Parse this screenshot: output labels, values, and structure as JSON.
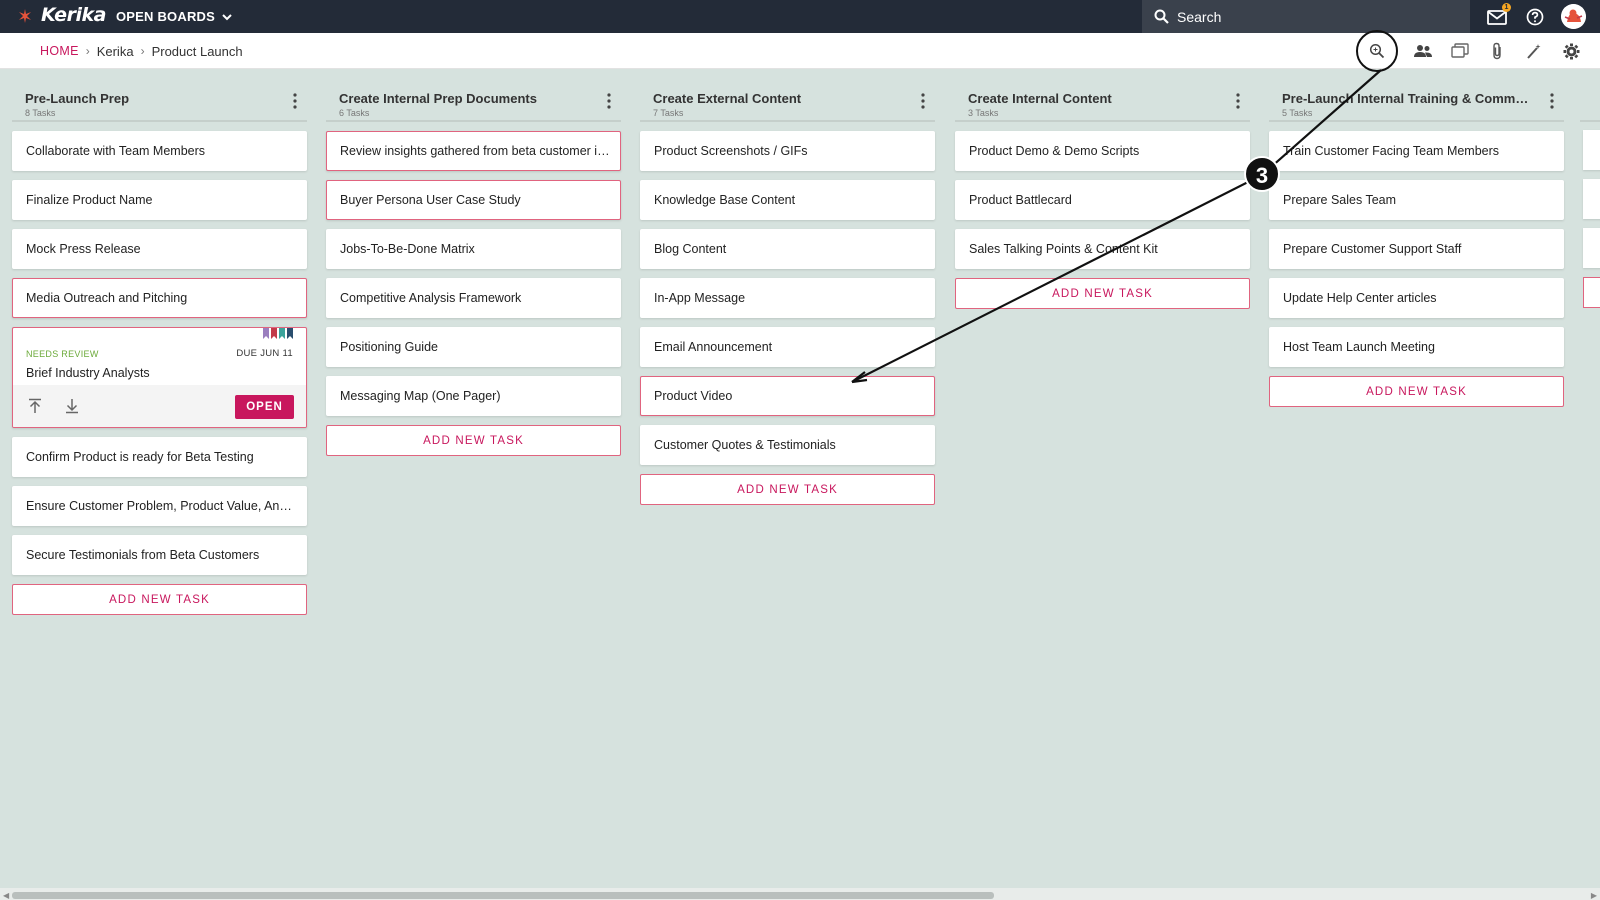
{
  "app": {
    "logo_text": "Kerika",
    "open_boards_label": "OPEN BOARDS",
    "search_placeholder": "Search",
    "mail_badge": "1"
  },
  "breadcrumb": {
    "home": "HOME",
    "workspace": "Kerika",
    "board": "Product Launch"
  },
  "columns": [
    {
      "title": "Pre-Launch Prep",
      "count": "8 Tasks",
      "cards_before": [
        {
          "label": "Collaborate with Team Members",
          "highlight": false
        },
        {
          "label": "Finalize Product Name",
          "highlight": false
        },
        {
          "label": "Mock Press Release",
          "highlight": false
        },
        {
          "label": "Media Outreach and Pitching",
          "highlight": true
        }
      ],
      "expanded_card": {
        "status": "NEEDS REVIEW",
        "due": "DUE JUN 11",
        "title": "Brief Industry Analysts",
        "open_label": "OPEN",
        "tag_colors": [
          "#9b7fbf",
          "#c23b4a",
          "#3aa39b",
          "#2a4e6e"
        ]
      },
      "cards_after": [
        {
          "label": "Confirm Product is ready for Beta Testing",
          "highlight": false
        },
        {
          "label": "Ensure Customer Problem, Product Value, And U...",
          "highlight": false
        },
        {
          "label": "Secure Testimonials from Beta Customers",
          "highlight": false
        }
      ],
      "add_label": "ADD NEW TASK"
    },
    {
      "title": "Create Internal Prep Documents",
      "count": "6 Tasks",
      "cards": [
        {
          "label": "Review insights gathered from beta customer in...",
          "highlight": true
        },
        {
          "label": "Buyer Persona User Case Study",
          "highlight": true
        },
        {
          "label": "Jobs-To-Be-Done Matrix",
          "highlight": false
        },
        {
          "label": "Competitive Analysis Framework",
          "highlight": false
        },
        {
          "label": "Positioning Guide",
          "highlight": false
        },
        {
          "label": "Messaging Map (One Pager)",
          "highlight": false
        }
      ],
      "add_label": "ADD NEW TASK"
    },
    {
      "title": "Create External Content",
      "count": "7 Tasks",
      "cards": [
        {
          "label": "Product Screenshots / GIFs",
          "highlight": false
        },
        {
          "label": "Knowledge Base Content",
          "highlight": false
        },
        {
          "label": "Blog Content",
          "highlight": false
        },
        {
          "label": "In-App Message",
          "highlight": false
        },
        {
          "label": "Email Announcement",
          "highlight": false
        },
        {
          "label": "Product Video",
          "highlight": true
        },
        {
          "label": "Customer Quotes & Testimonials",
          "highlight": false
        }
      ],
      "add_label": "ADD NEW TASK"
    },
    {
      "title": "Create Internal Content",
      "count": "3 Tasks",
      "cards": [
        {
          "label": "Product Demo & Demo Scripts",
          "highlight": false
        },
        {
          "label": "Product Battlecard",
          "highlight": false
        },
        {
          "label": "Sales Talking Points & Content Kit",
          "highlight": false
        }
      ],
      "add_label": "ADD NEW TASK"
    },
    {
      "title": "Pre-Launch Internal Training & Communi...",
      "count": "5 Tasks",
      "cards": [
        {
          "label": "Train Customer Facing Team Members",
          "highlight": false
        },
        {
          "label": "Prepare Sales Team",
          "highlight": false
        },
        {
          "label": "Prepare Customer Support Staff",
          "highlight": false
        },
        {
          "label": "Update Help Center articles",
          "highlight": false
        },
        {
          "label": "Host Team Launch Meeting",
          "highlight": false
        }
      ],
      "add_label": "ADD NEW TASK"
    }
  ],
  "annotation": {
    "step_number": "3"
  },
  "colors": {
    "accent": "#c8175d",
    "topbar": "#232b38",
    "board_bg": "#d6e2de"
  }
}
